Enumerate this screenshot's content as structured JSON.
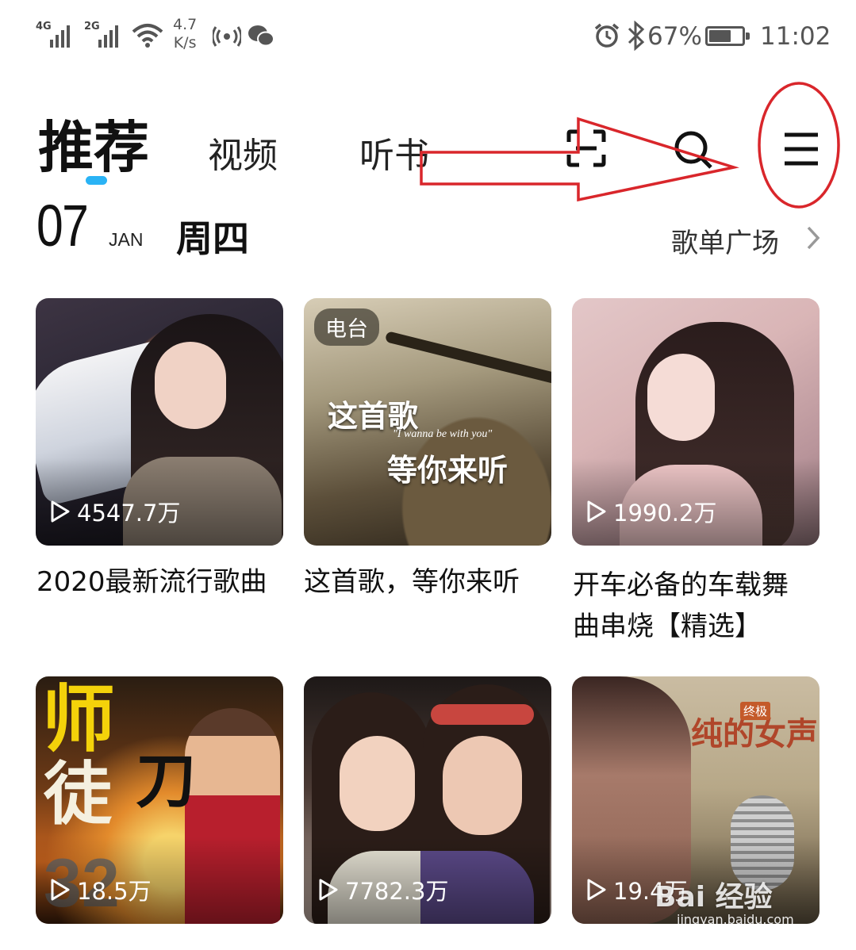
{
  "status_bar": {
    "signal_1_label": "4G",
    "signal_2_label": "2G",
    "net_speed_value": "4.7",
    "net_speed_unit": "K/s",
    "battery_percent": "67%",
    "time": "11:02",
    "icons": [
      "signal-icon",
      "wifi-icon",
      "hotspot-icon",
      "wechat-icon",
      "alarm-icon",
      "bluetooth-icon",
      "battery-icon"
    ]
  },
  "header": {
    "tabs": [
      {
        "label": "推荐",
        "active": true
      },
      {
        "label": "视频",
        "active": false
      },
      {
        "label": "听书",
        "active": false
      }
    ],
    "icons": [
      "scan-icon",
      "search-icon",
      "menu-icon"
    ],
    "indicator_color": "#2ab3f5"
  },
  "date_row": {
    "day": "07",
    "month": "JAN",
    "weekday": "周四",
    "playlist_plaza": "歌单广场"
  },
  "cards": [
    {
      "title": "2020最新流行歌曲",
      "play_count": "4547.7万",
      "tag": ""
    },
    {
      "title": "这首歌，等你来听",
      "play_count": "",
      "tag": "电台",
      "art_text_1": "这首歌",
      "art_text_2": "\"I wanna be with you\"",
      "art_text_3": "等你来听"
    },
    {
      "title_line_1": "开车必备的车载舞",
      "title_line_2": "曲串烧【精选】",
      "play_count": "1990.2万",
      "tag": ""
    },
    {
      "title": "",
      "play_count": "18.5万",
      "art_text_1": "师",
      "art_text_2": "徒",
      "art_text_3": "刀",
      "art_text_4": "32"
    },
    {
      "title": "",
      "play_count": "7782.3万"
    },
    {
      "title": "",
      "play_count": "19.4万",
      "art_text_1": "纯的女声",
      "art_text_2": "终极"
    }
  ],
  "annotation": {
    "type": "red-arrow-and-ellipse",
    "target": "menu-icon",
    "color": "#d9262b"
  },
  "watermark": {
    "brand": "Bai 经验",
    "url": "jingyan.baidu.com"
  }
}
